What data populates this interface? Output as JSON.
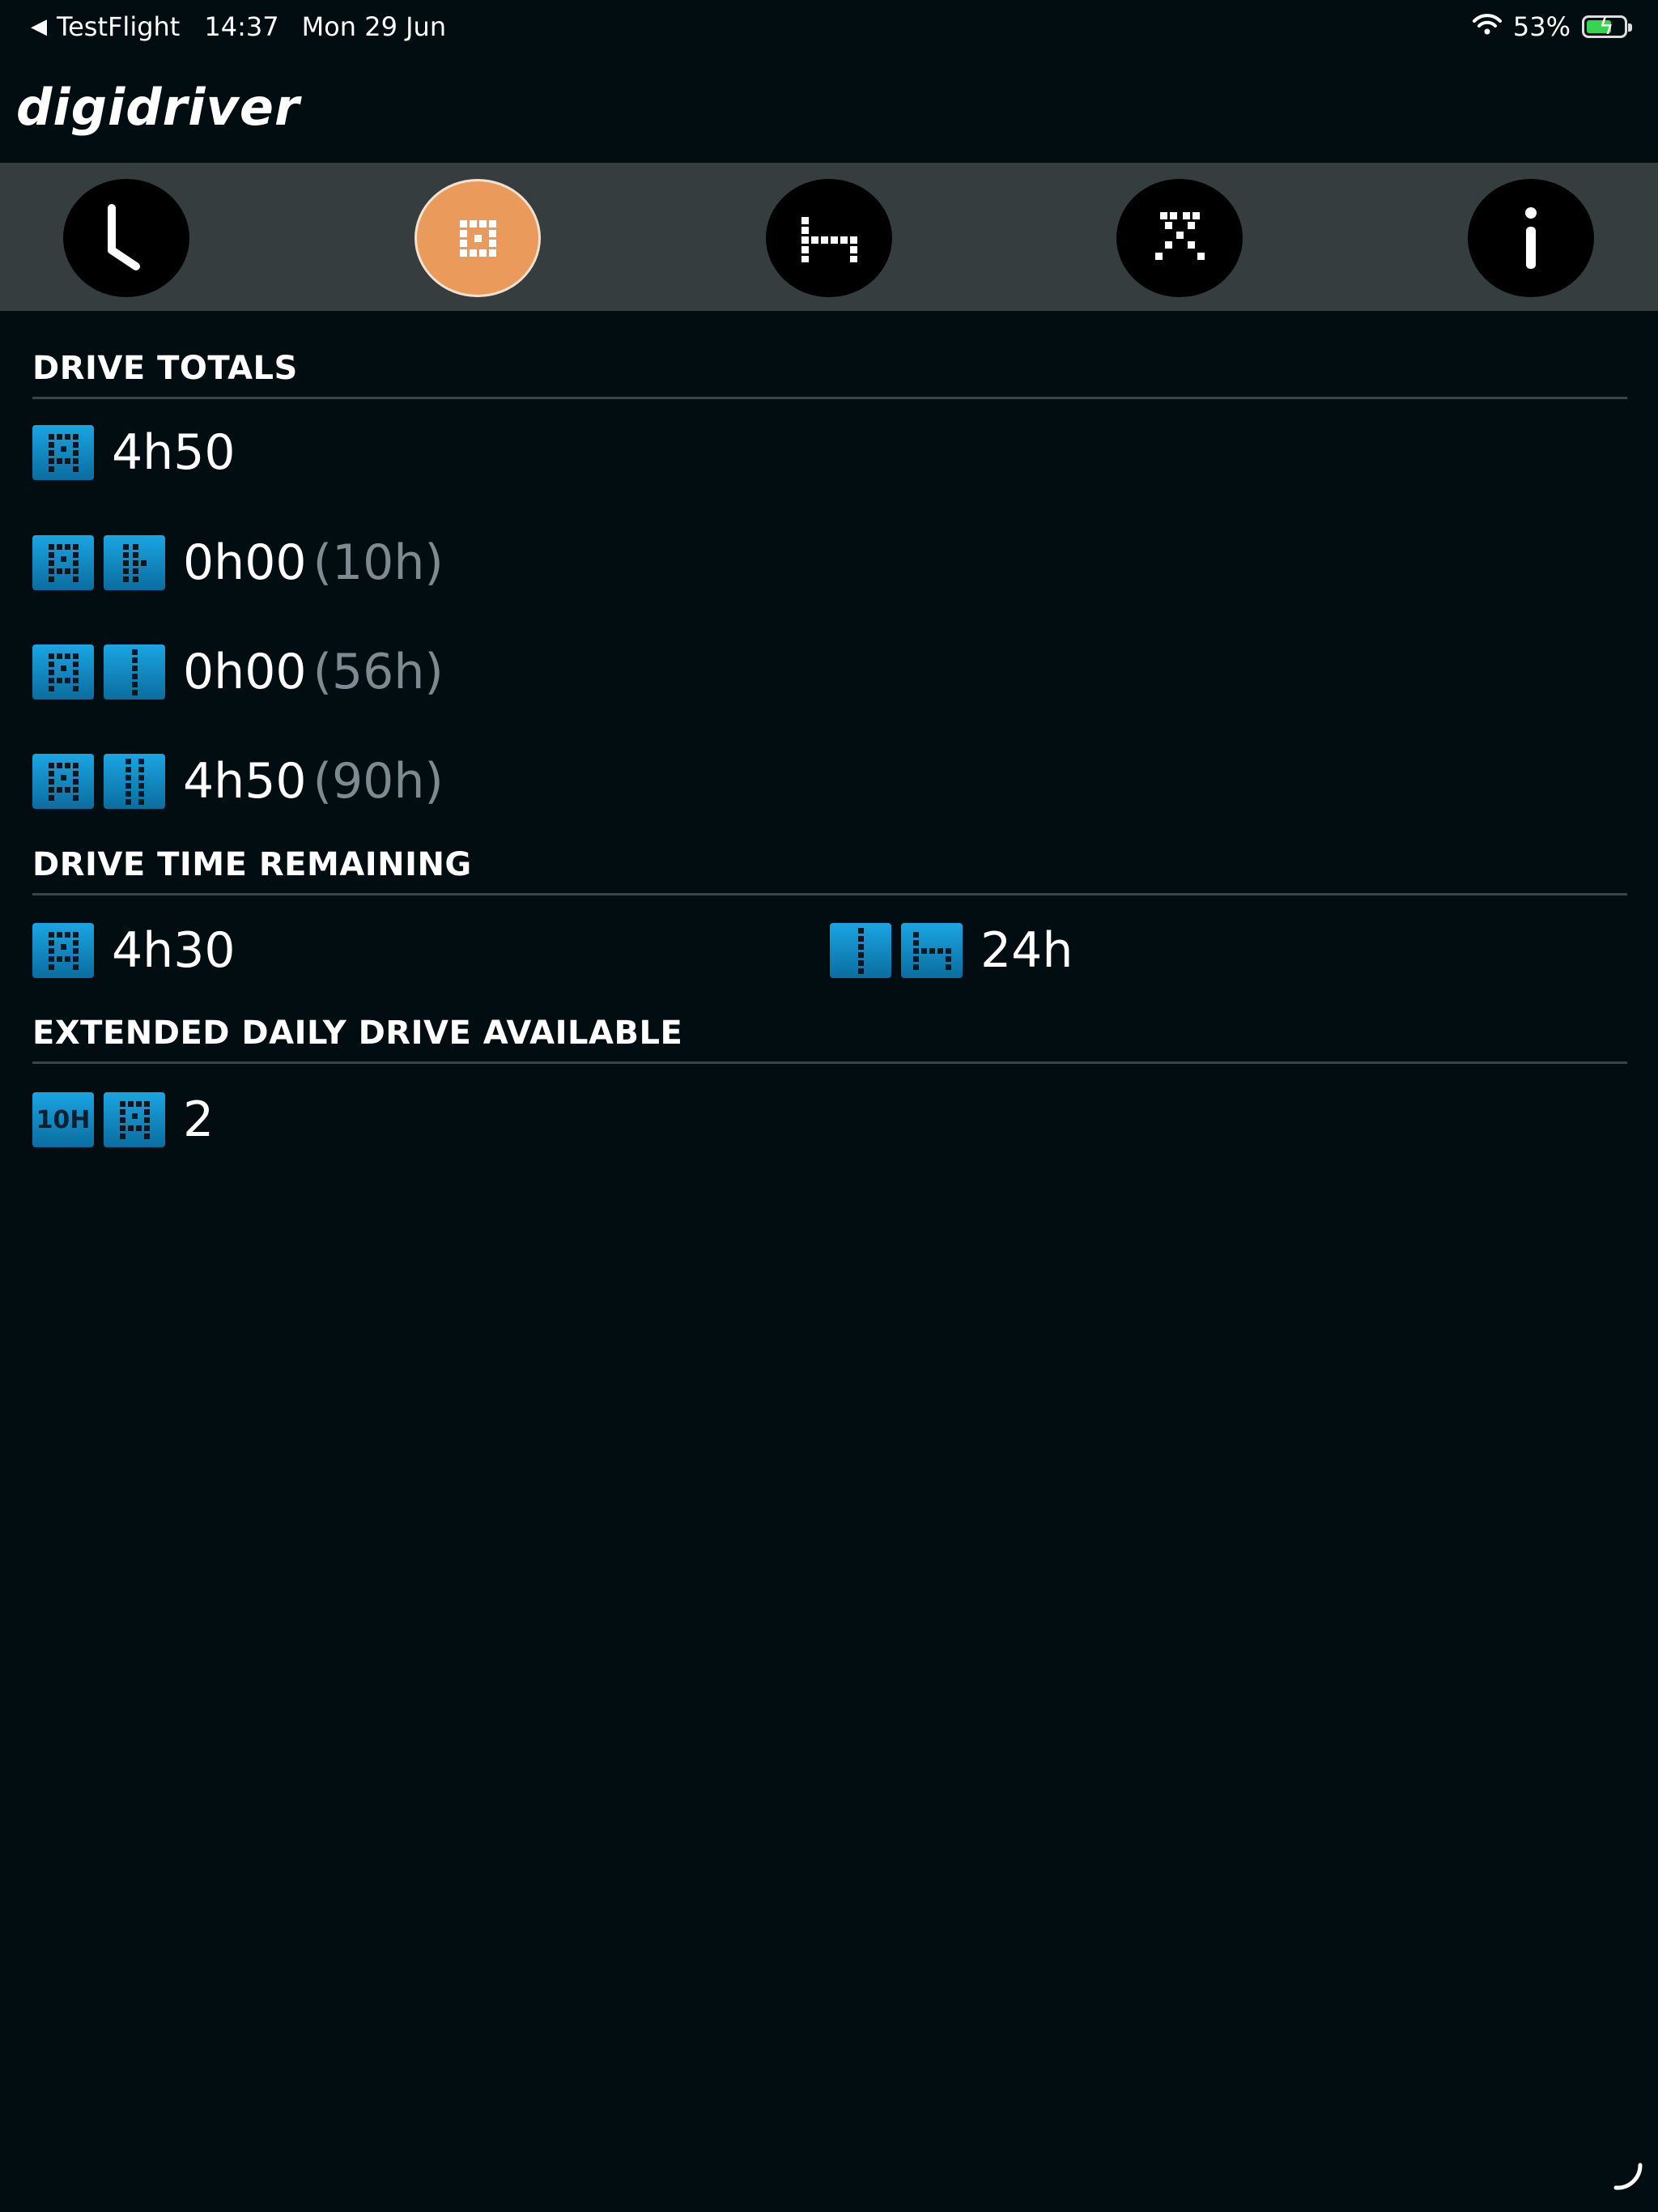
{
  "status_bar": {
    "back_label": "◀",
    "app": "TestFlight",
    "time": "14:37",
    "date": "Mon 29 Jun",
    "battery_pct": "53%"
  },
  "brand": "digidriver",
  "nav": {
    "items": [
      {
        "name": "clock",
        "active": false
      },
      {
        "name": "drive",
        "active": true
      },
      {
        "name": "rest",
        "active": false
      },
      {
        "name": "work",
        "active": false
      },
      {
        "name": "info",
        "active": false
      }
    ]
  },
  "sections": {
    "drive_totals": {
      "title": "DRIVE TOTALS",
      "rows": [
        {
          "value": "4h50",
          "limit": ""
        },
        {
          "value": "0h00",
          "limit": "(10h)"
        },
        {
          "value": "0h00",
          "limit": "(56h)"
        },
        {
          "value": "4h50",
          "limit": "(90h)"
        }
      ]
    },
    "drive_time_remaining": {
      "title": "DRIVE TIME REMAINING",
      "left_value": "4h30",
      "right_value": "24h"
    },
    "extended_daily": {
      "title": "EXTENDED DAILY DRIVE AVAILABLE",
      "badge": "10H",
      "value": "2"
    }
  },
  "colors": {
    "background": "#020d12",
    "nav_bar": "#353d3f",
    "accent": "#ea9a5b",
    "tile": "#1596d1",
    "muted": "#7d8b90"
  }
}
